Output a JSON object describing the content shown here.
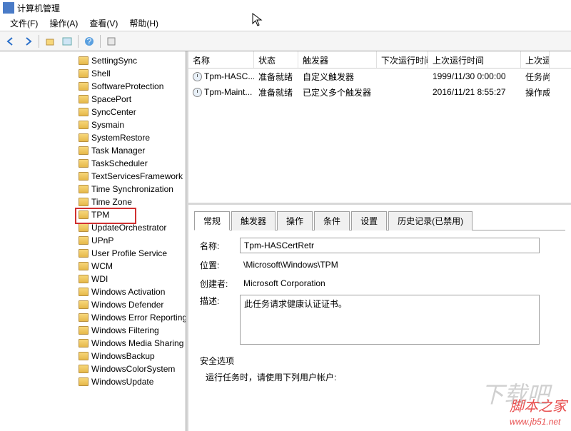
{
  "window": {
    "title": "计算机管理"
  },
  "menu": {
    "file": "文件(F)",
    "action": "操作(A)",
    "view": "查看(V)",
    "help": "帮助(H)"
  },
  "tree": {
    "items": [
      {
        "label": "SettingSync"
      },
      {
        "label": "Shell"
      },
      {
        "label": "SoftwareProtection"
      },
      {
        "label": "SpacePort"
      },
      {
        "label": "SyncCenter"
      },
      {
        "label": "Sysmain"
      },
      {
        "label": "SystemRestore"
      },
      {
        "label": "Task Manager"
      },
      {
        "label": "TaskScheduler"
      },
      {
        "label": "TextServicesFramework"
      },
      {
        "label": "Time Synchronization"
      },
      {
        "label": "Time Zone"
      },
      {
        "label": "TPM",
        "highlighted": true
      },
      {
        "label": "UpdateOrchestrator"
      },
      {
        "label": "UPnP"
      },
      {
        "label": "User Profile Service"
      },
      {
        "label": "WCM"
      },
      {
        "label": "WDI"
      },
      {
        "label": "Windows Activation"
      },
      {
        "label": "Windows Defender"
      },
      {
        "label": "Windows Error Reporting"
      },
      {
        "label": "Windows Filtering"
      },
      {
        "label": "Windows Media Sharing"
      },
      {
        "label": "WindowsBackup"
      },
      {
        "label": "WindowsColorSystem"
      },
      {
        "label": "WindowsUpdate"
      }
    ]
  },
  "tasks": {
    "headers": {
      "name": "名称",
      "status": "状态",
      "trigger": "触发器",
      "next": "下次运行时间",
      "last": "上次运行时间",
      "result": "上次运行结果"
    },
    "rows": [
      {
        "name": "Tpm-HASC...",
        "status": "准备就绪",
        "trigger": "自定义触发器",
        "next": "",
        "last": "1999/11/30 0:00:00",
        "result": "任务尚未运行"
      },
      {
        "name": "Tpm-Maint...",
        "status": "准备就绪",
        "trigger": "已定义多个触发器",
        "next": "",
        "last": "2016/11/21 8:55:27",
        "result": "操作成功"
      }
    ]
  },
  "tabs": {
    "general": "常规",
    "triggers": "触发器",
    "actions": "操作",
    "conditions": "条件",
    "settings": "设置",
    "history": "历史记录(已禁用)"
  },
  "detail": {
    "nameLabel": "名称:",
    "name": "Tpm-HASCertRetr",
    "locationLabel": "位置:",
    "location": "\\Microsoft\\Windows\\TPM",
    "authorLabel": "创建者:",
    "author": "Microsoft Corporation",
    "descLabel": "描述:",
    "desc": "此任务请求健康认证证书。",
    "securityLabel": "安全选项",
    "securityText": "运行任务时，请使用下列用户帐户:"
  },
  "watermark": {
    "han": "脚本之家",
    "url": "www.jb51.net"
  },
  "watermark2": "下载吧"
}
